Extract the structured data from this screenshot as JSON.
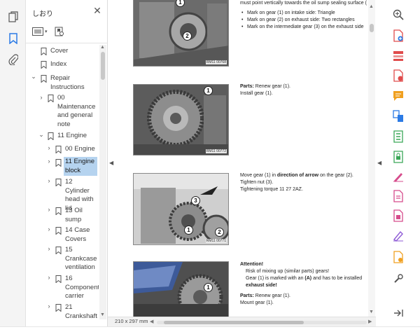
{
  "panel": {
    "title": "しおり",
    "close_glyph": "✕"
  },
  "tree": [
    {
      "label": "Cover",
      "level": 0,
      "chevron": ""
    },
    {
      "label": "Index",
      "level": 0,
      "chevron": ""
    },
    {
      "label": "Repair Instructions",
      "level": 0,
      "chevron": "⌄"
    },
    {
      "label": "00 Maintenance and general note",
      "level": 1,
      "chevron": "›"
    },
    {
      "label": "11 Engine",
      "level": 1,
      "chevron": "⌄"
    },
    {
      "label": "00 Engine",
      "level": 2,
      "chevron": "›"
    },
    {
      "label": "11 Engine block",
      "level": 2,
      "chevron": "›",
      "selected": true
    },
    {
      "label": "12 Cylinder head with lid",
      "level": 2,
      "chevron": "›"
    },
    {
      "label": "13 Oil sump",
      "level": 2,
      "chevron": "›"
    },
    {
      "label": "14 Case Covers",
      "level": 2,
      "chevron": "›"
    },
    {
      "label": "15 Crankcase ventilation",
      "level": 2,
      "chevron": "›"
    },
    {
      "label": "16 Component carrier",
      "level": 2,
      "chevron": "›"
    },
    {
      "label": "21 Crankshaft",
      "level": 2,
      "chevron": "›"
    }
  ],
  "document": {
    "top_text_1": "must point vertically towards the oil sump sealing surface (",
    "bullets": [
      "Mark on gear (1) on intake side: Triangle",
      "Mark on gear (2) on exhaust side: Two rectangles",
      "Mark on the intermediate gear (3) on the exhaust side"
    ],
    "block2": {
      "parts_label": "Parts:",
      "parts_text": " Renew gear (1).",
      "install": "Install gear (1)."
    },
    "block3": {
      "move_pre": "Move gear (1) in ",
      "move_bold": "direction of arrow",
      "move_post": " on the gear (2).",
      "tighten": "Tighten nut (3).",
      "torque": "Tightening torque 11 27 2AZ."
    },
    "block4": {
      "attention": "Attention!",
      "risk": "Risk of mixing up (similar parts) gears!",
      "marked_pre": "Gear (1) is marked with an ",
      "marked_bold": "(A)",
      "marked_post": " and has to be installed",
      "exhaust": "exhaust side!",
      "parts_label": "Parts:",
      "parts_text": " Renew gear (1).",
      "mount": "Mount gear (1)."
    },
    "photo_labels": [
      "RM11 00768",
      "RM11 00772",
      "RM11 00771",
      ""
    ],
    "callouts": {
      "p1": [
        "1",
        "2"
      ],
      "p2": [
        "1"
      ],
      "p3": [
        "1",
        "2",
        "3"
      ],
      "p4": [
        "1"
      ]
    }
  },
  "status": {
    "page_size": "210 x 297 mm"
  },
  "colors": {
    "accent_blue": "#2c7be5",
    "selection": "#b5d3ef",
    "tool_green": "#3aa757",
    "tool_red": "#e04c4c",
    "tool_purple": "#8f5bd6",
    "tool_orange": "#f0a020",
    "tool_pink": "#d64c8c"
  },
  "icons": {
    "rail": [
      "pages-icon",
      "bookmarks-icon",
      "attachments-icon"
    ],
    "right_tools": [
      "zoom-icon",
      "create-pdf-icon",
      "organize-pages-icon",
      "export-pdf-icon",
      "comment-icon",
      "combine-files-icon",
      "compress-pdf-icon",
      "protect-icon",
      "fill-sign-icon",
      "edit-pdf-icon",
      "send-for-review-icon",
      "request-signatures-icon",
      "measure-icon",
      "more-tools-icon",
      "expand-panel-icon"
    ]
  }
}
